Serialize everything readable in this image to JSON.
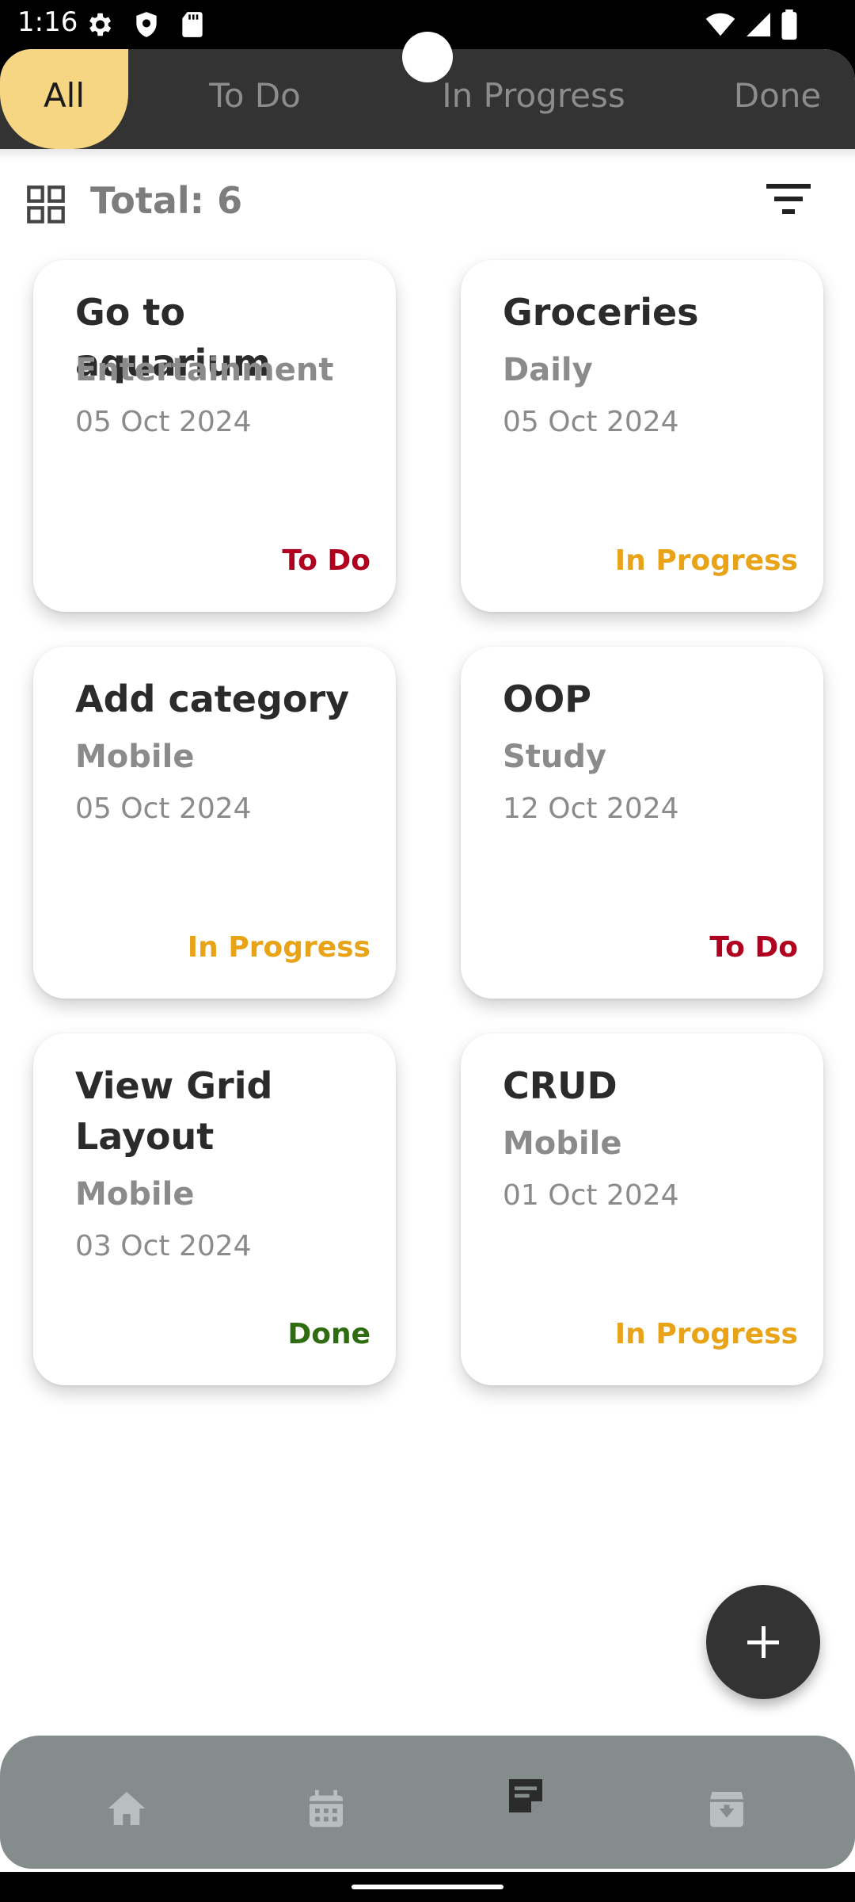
{
  "status_bar": {
    "time": "1:16",
    "icons": [
      "settings-icon",
      "shield-icon",
      "sd-card-icon",
      "wifi-icon",
      "cell-signal-icon",
      "battery-icon"
    ]
  },
  "tabs": [
    {
      "label": "All",
      "active": true
    },
    {
      "label": "To Do",
      "active": false
    },
    {
      "label": "In Progress",
      "active": false
    },
    {
      "label": "Done",
      "active": false
    }
  ],
  "toolbar": {
    "total_label": "Total: 6",
    "grid_icon": "grid-view-icon",
    "filter_icon": "filter-icon"
  },
  "tasks": [
    {
      "title": "Go to aquarium",
      "category": "Entertainment",
      "date": "05 Oct 2024",
      "status": "To Do"
    },
    {
      "title": "Groceries",
      "category": "Daily",
      "date": "05 Oct 2024",
      "status": "In Progress"
    },
    {
      "title": "Add category",
      "category": "Mobile",
      "date": "05 Oct 2024",
      "status": "In Progress"
    },
    {
      "title": "OOP",
      "category": "Study",
      "date": "12 Oct 2024",
      "status": "To Do"
    },
    {
      "title": "View Grid Layout",
      "category": "Mobile",
      "date": "03 Oct 2024",
      "status": "Done"
    },
    {
      "title": "CRUD",
      "category": "Mobile",
      "date": "01 Oct 2024",
      "status": "In Progress"
    }
  ],
  "status_colors": {
    "To Do": "#b00020",
    "In Progress": "#e8a317",
    "Done": "#2e6b11"
  },
  "colors": {
    "tab_bar": "#333333",
    "tab_active": "#f7d683",
    "bottom_nav": "#858c8c",
    "fab": "#333333"
  },
  "bottom_nav": {
    "items": [
      "home-icon",
      "calendar-icon",
      "notes-icon",
      "archive-icon"
    ],
    "active": "notes-icon"
  },
  "fab": {
    "icon": "plus-icon"
  }
}
